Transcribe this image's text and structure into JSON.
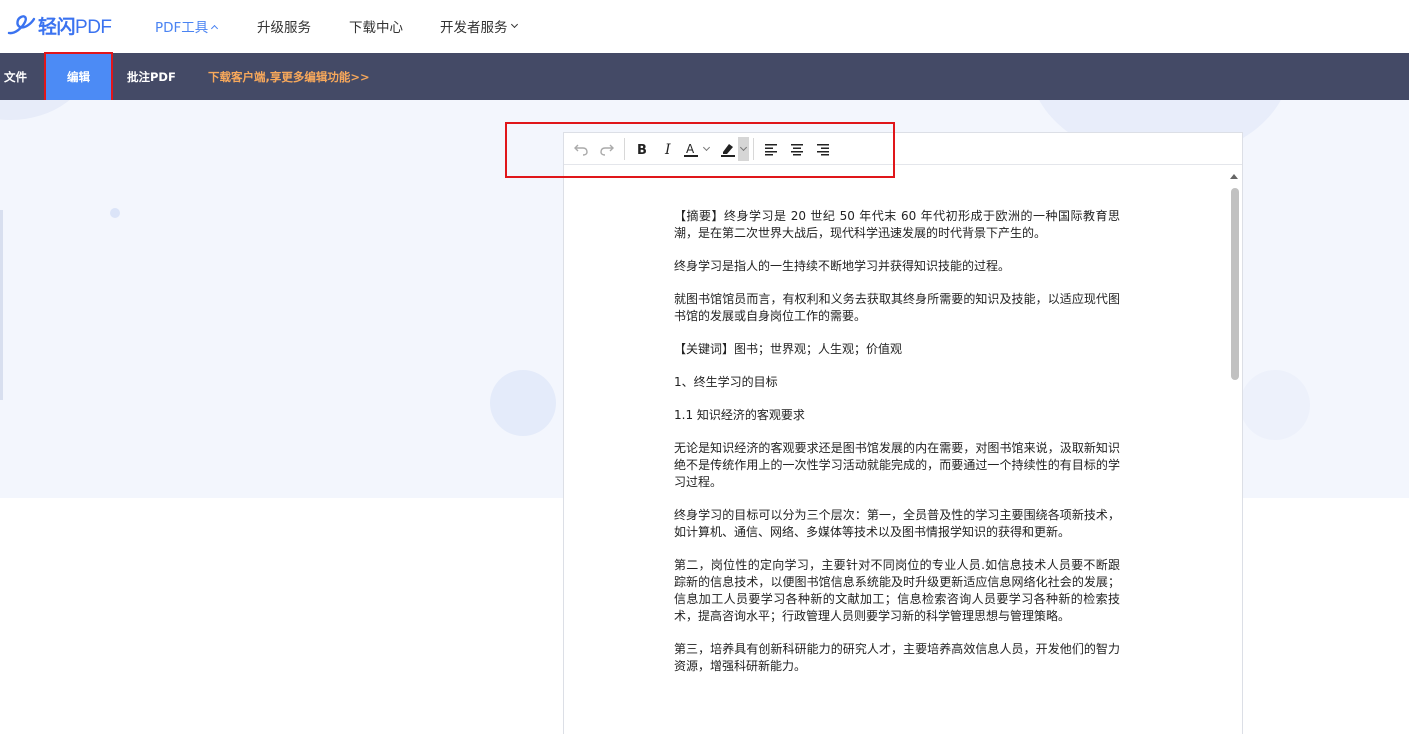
{
  "topnav": {
    "logo": {
      "brand": "轻闪",
      "pdf": "PDF"
    },
    "items": [
      {
        "label": "PDF工具",
        "active": true,
        "caret": "up"
      },
      {
        "label": "升级服务"
      },
      {
        "label": "下载中心"
      },
      {
        "label": "开发者服务",
        "caret": "down"
      }
    ]
  },
  "toolbar": {
    "file": "文件",
    "edit": "编辑",
    "annotate": "批注PDF",
    "promo": "下载客户端,享更多编辑功能>>"
  },
  "editor_toolbar": {
    "icons": [
      "undo-icon",
      "redo-icon",
      "bold-icon",
      "italic-icon",
      "font-color-icon",
      "highlight-icon",
      "align-left-icon",
      "align-center-icon",
      "align-right-icon"
    ]
  },
  "document": {
    "paragraphs": [
      "【摘要】终身学习是 20 世纪 50 年代末 60 年代初形成于欧洲的一种国际教育思潮，是在第二次世界大战后，现代科学迅速发展的时代背景下产生的。",
      "终身学习是指人的一生持续不断地学习并获得知识技能的过程。",
      "就图书馆馆员而言，有权利和义务去获取其终身所需要的知识及技能，以适应现代图书馆的发展或自身岗位工作的需要。",
      "【关键词】图书；世界观；人生观；价值观",
      "1、终生学习的目标",
      "1.1 知识经济的客观要求",
      "无论是知识经济的客观要求还是图书馆发展的内在需要，对图书馆来说，汲取新知识绝不是传统作用上的一次性学习活动就能完成的，而要通过一个持续性的有目标的学习过程。",
      "终身学习的目标可以分为三个层次：第一，全员普及性的学习主要围绕各项新技术，如计算机、通信、网络、多媒体等技术以及图书情报学知识的获得和更新。",
      "第二，岗位性的定向学习，主要针对不同岗位的专业人员.如信息技术人员要不断跟踪新的信息技术，以便图书馆信息系统能及时升级更新适应信息网络化社会的发展；信息加工人员要学习各种新的文献加工；信息检索咨询人员要学习各种新的检索技术，提高咨询水平；行政管理人员则要学习新的科学管理思想与管理策略。",
      "第三，培养具有创新科研能力的研究人才，主要培养高效信息人员，开发他们的智力资源，增强科研新能力。"
    ]
  },
  "colors": {
    "brand": "#3b73f0",
    "toolbar_bg": "#444a66",
    "active_tab": "#4c8bf5",
    "promo": "#f7a85b",
    "highlight_box": "#e0161a"
  }
}
